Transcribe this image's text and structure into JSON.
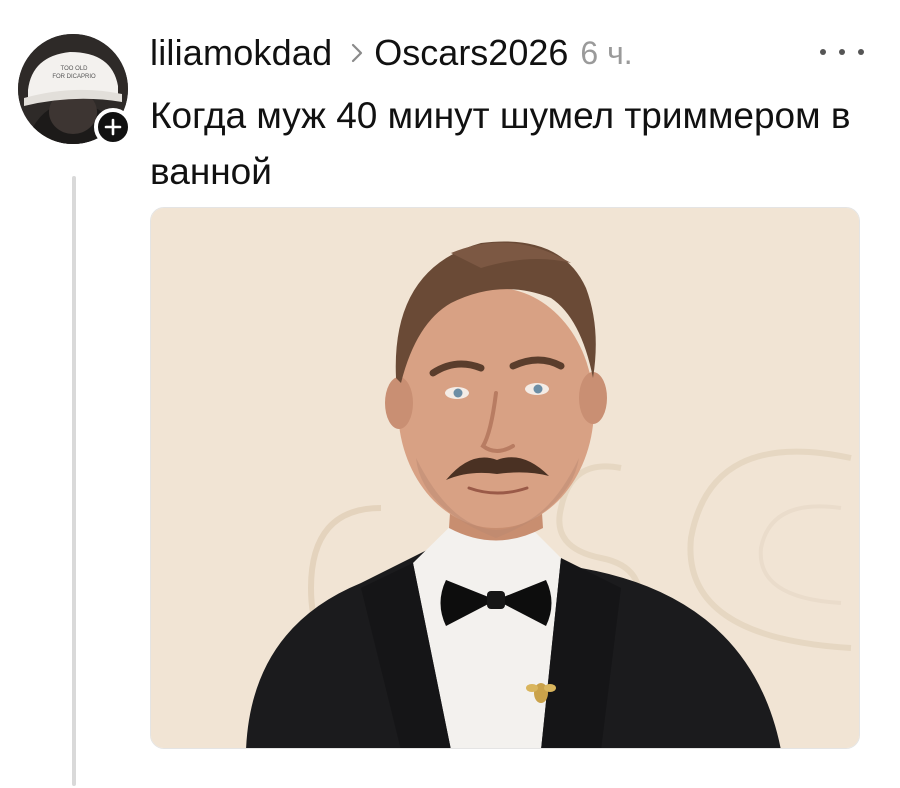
{
  "post": {
    "username": "liliamokdad",
    "community": "Oscars2026",
    "time": "6 ч.",
    "text": "Когда муж 40 минут шумел триммером в ванной",
    "avatar_cap_text": "TOO OLD FOR DICAPRIO"
  },
  "icons": {
    "avatar": "profile-avatar",
    "follow": "plus-icon",
    "separator": "chevron-right-icon",
    "menu": "more-horizontal-icon"
  },
  "colors": {
    "text": "#111111",
    "muted": "#9a9a9a",
    "thread_line": "#d9d9d9",
    "image_background": "#efe2d1"
  }
}
